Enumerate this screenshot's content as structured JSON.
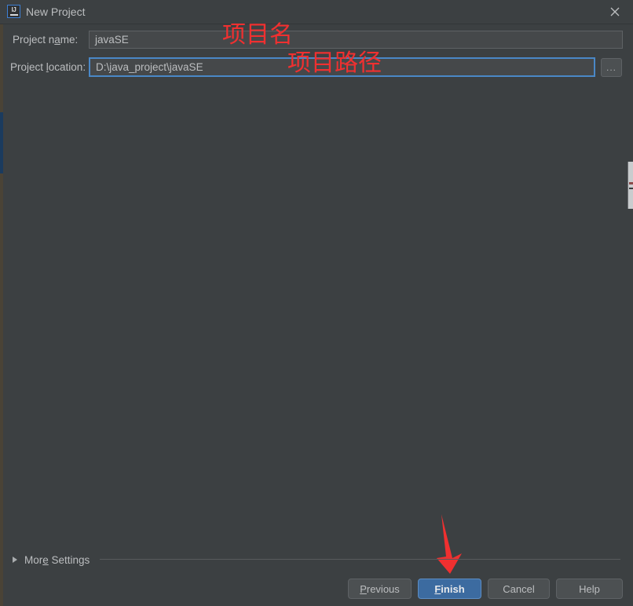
{
  "window": {
    "title": "New Project",
    "app_icon": "intellij-idea-icon",
    "close_icon": "close-icon"
  },
  "form": {
    "name_row": {
      "label_before": "Project n",
      "label_mnemonic": "a",
      "label_after": "me:",
      "value": "javaSE"
    },
    "location_row": {
      "label_before": "Project ",
      "label_mnemonic": "l",
      "label_after": "ocation:",
      "value": "D:\\java_project\\javaSE",
      "browse_label": "..."
    }
  },
  "annotations": [
    {
      "text": "项目名",
      "color": "#f03030"
    },
    {
      "text": "项目路径",
      "color": "#f03030"
    }
  ],
  "more_settings": {
    "label_before": "Mor",
    "label_mnemonic": "e",
    "label_after": " Settings",
    "expanded": false,
    "triangle_icon": "chevron-right-icon"
  },
  "buttons": {
    "previous": {
      "mnemonic": "P",
      "rest": "revious"
    },
    "finish": {
      "mnemonic": "F",
      "rest": "inish"
    },
    "cancel": {
      "label": "Cancel"
    },
    "help": {
      "label": "Help"
    }
  },
  "colors": {
    "background": "#3c4042",
    "field_background": "#45484a",
    "focus_border": "#4a88c7",
    "default_button": "#3c6ba0",
    "annotation_red": "#f03030",
    "text": "#bcbec0"
  }
}
